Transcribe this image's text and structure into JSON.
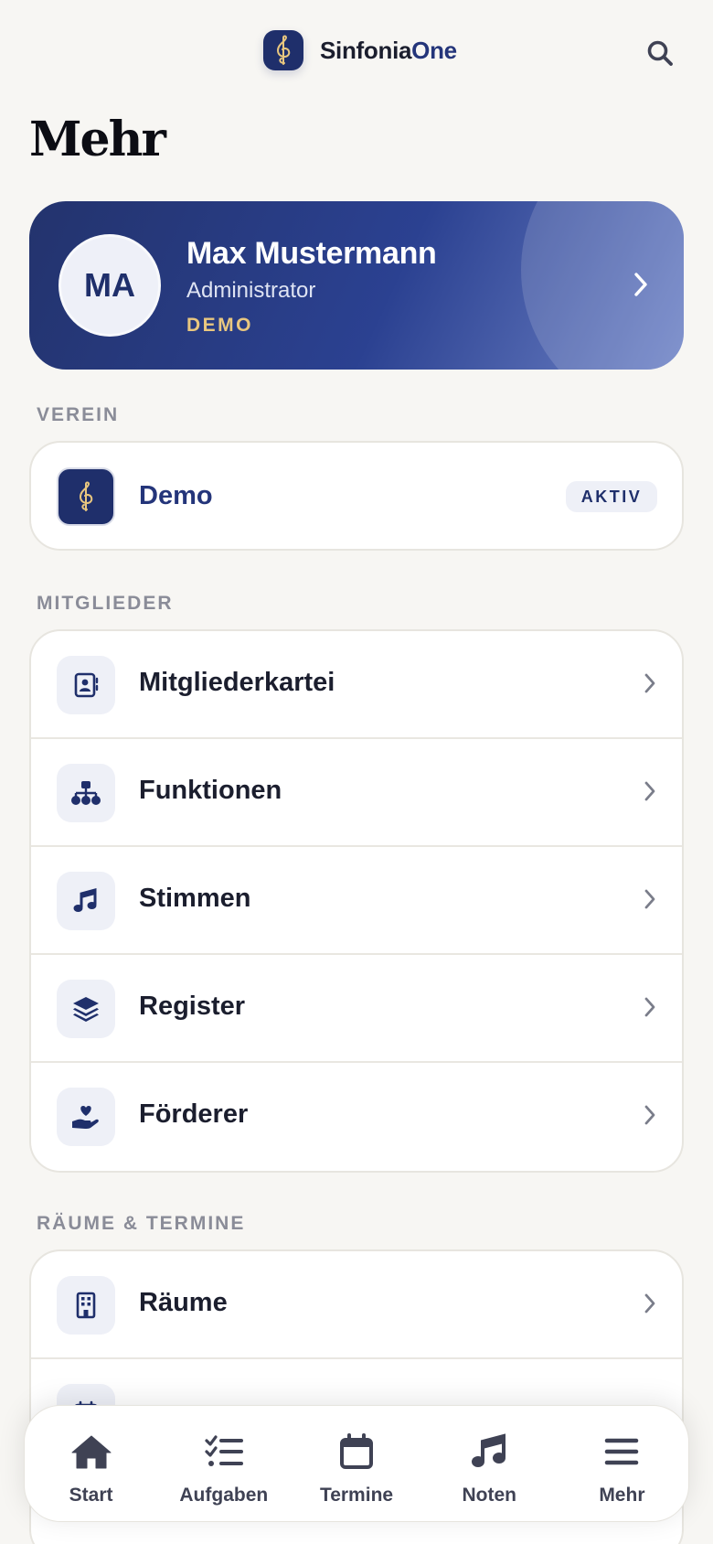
{
  "header": {
    "brand_part1": "Sinfonia",
    "brand_part2": "One",
    "logo_icon": "treble-clef-icon",
    "search_icon": "search-icon"
  },
  "page": {
    "title": "Mehr"
  },
  "profile": {
    "initials": "MA",
    "name": "Max Mustermann",
    "role": "Administrator",
    "badge": "DEMO"
  },
  "verein": {
    "section_label": "VEREIN",
    "name": "Demo",
    "status": "AKTIV"
  },
  "mitglieder": {
    "section_label": "MITGLIEDER",
    "items": [
      {
        "label": "Mitgliederkartei",
        "icon": "contact-card-icon"
      },
      {
        "label": "Funktionen",
        "icon": "org-chart-icon"
      },
      {
        "label": "Stimmen",
        "icon": "music-note-icon"
      },
      {
        "label": "Register",
        "icon": "layers-icon"
      },
      {
        "label": "Förderer",
        "icon": "hand-heart-icon"
      }
    ]
  },
  "raeume": {
    "section_label": "RÄUME & TERMINE",
    "items": [
      {
        "label": "Räume",
        "icon": "building-icon"
      },
      {
        "label": "",
        "icon": "calendar-icon"
      }
    ]
  },
  "nav": {
    "items": [
      {
        "label": "Start",
        "icon": "home-icon"
      },
      {
        "label": "Aufgaben",
        "icon": "checklist-icon"
      },
      {
        "label": "Termine",
        "icon": "calendar-icon"
      },
      {
        "label": "Noten",
        "icon": "music-note-icon"
      },
      {
        "label": "Mehr",
        "icon": "menu-icon"
      }
    ]
  },
  "colors": {
    "primary": "#1f2f6b",
    "accent_gold": "#e9c77f",
    "background": "#f7f6f3"
  }
}
